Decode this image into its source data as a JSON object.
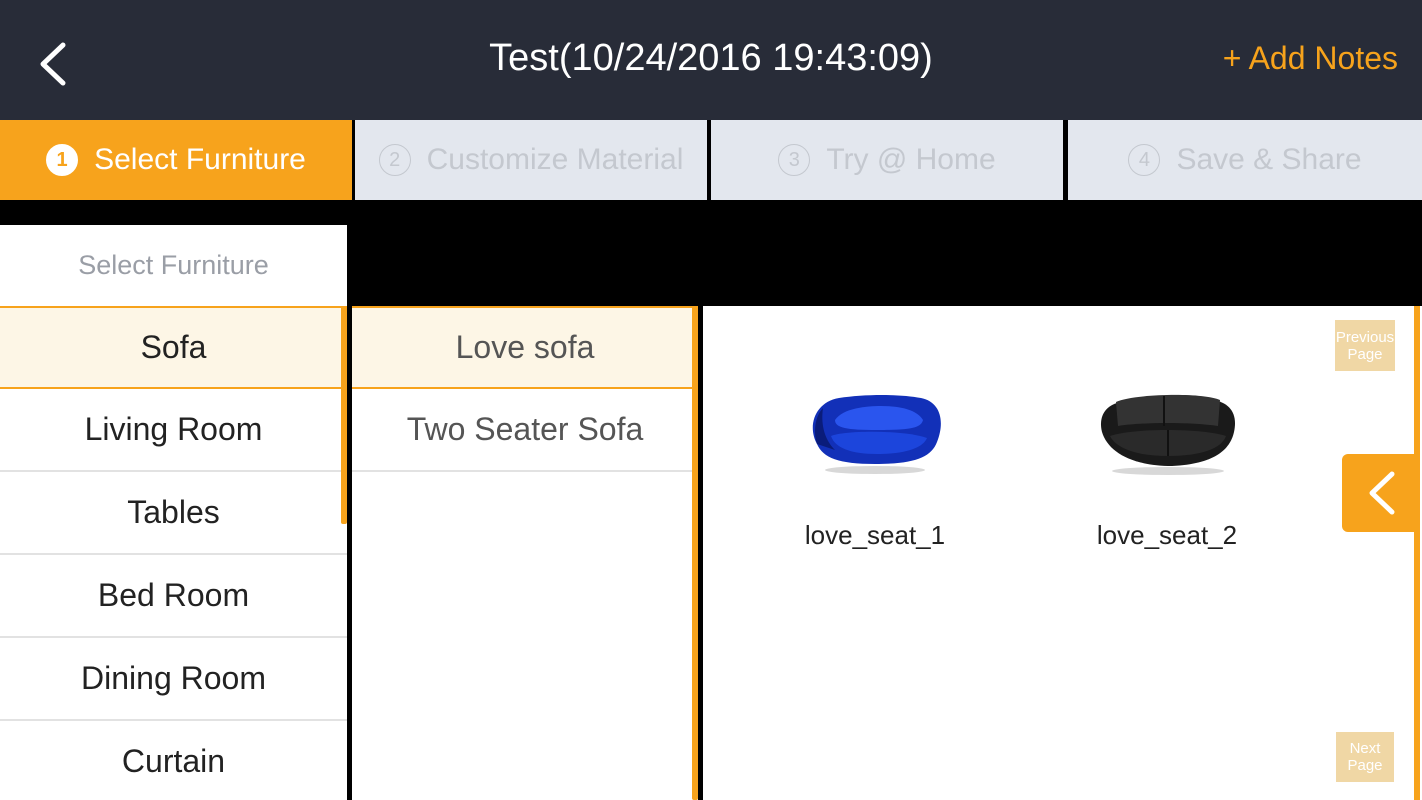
{
  "header": {
    "title": "Test(10/24/2016 19:43:09)",
    "add_notes_label": "+ Add Notes",
    "back_icon": "chevron-left-icon"
  },
  "steps": [
    {
      "number": "1",
      "label": "Select Furniture",
      "active": true
    },
    {
      "number": "2",
      "label": "Customize Material",
      "active": false
    },
    {
      "number": "3",
      "label": "Try @ Home",
      "active": false
    },
    {
      "number": "4",
      "label": "Save & Share",
      "active": false
    }
  ],
  "panel_header": "Select Furniture",
  "categories": [
    "Sofa",
    "Living Room",
    "Tables",
    "Bed Room",
    "Dining Room",
    "Curtain"
  ],
  "selected_category": "Sofa",
  "subcategories": [
    "Love sofa",
    "Two Seater Sofa"
  ],
  "selected_subcategory": "Love sofa",
  "products": [
    {
      "name": "love_seat_1",
      "color": "#1436c8"
    },
    {
      "name": "love_seat_2",
      "color": "#1c1c1c"
    }
  ],
  "pagination": {
    "previous_label": "Previous Page",
    "next_label": "Next Page"
  },
  "colors": {
    "accent": "#f7a31c",
    "topbar": "#282c38",
    "inactive_step": "#e3e7ee"
  }
}
